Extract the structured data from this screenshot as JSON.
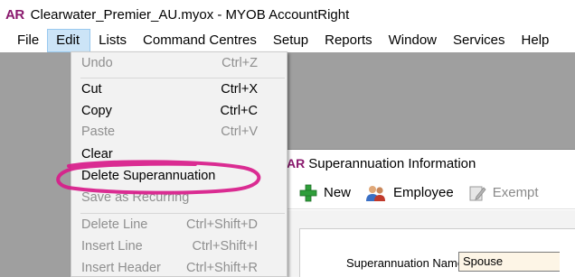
{
  "titlebar": {
    "logo": "AR",
    "title": "Clearwater_Premier_AU.myox - MYOB AccountRight"
  },
  "menubar": {
    "items": [
      {
        "label": "File"
      },
      {
        "label": "Edit"
      },
      {
        "label": "Lists"
      },
      {
        "label": "Command Centres"
      },
      {
        "label": "Setup"
      },
      {
        "label": "Reports"
      },
      {
        "label": "Window"
      },
      {
        "label": "Services"
      },
      {
        "label": "Help"
      }
    ]
  },
  "edit_menu": {
    "items": [
      {
        "label": "Undo",
        "shortcut": "Ctrl+Z",
        "enabled": false
      },
      {
        "label": "Cut",
        "shortcut": "Ctrl+X",
        "enabled": true
      },
      {
        "label": "Copy",
        "shortcut": "Ctrl+C",
        "enabled": true
      },
      {
        "label": "Paste",
        "shortcut": "Ctrl+V",
        "enabled": false
      },
      {
        "label": "Clear",
        "shortcut": "",
        "enabled": true
      },
      {
        "label": "Delete Superannuation",
        "shortcut": "",
        "enabled": true,
        "highlighted": true
      },
      {
        "label": "Save as Recurring",
        "shortcut": "",
        "enabled": false
      },
      {
        "label": "Delete Line",
        "shortcut": "Ctrl+Shift+D",
        "enabled": false
      },
      {
        "label": "Insert Line",
        "shortcut": "Ctrl+Shift+I",
        "enabled": false
      },
      {
        "label": "Insert Header",
        "shortcut": "Ctrl+Shift+R",
        "enabled": false
      }
    ]
  },
  "child_window": {
    "logo": "AR",
    "title": "Superannuation Information",
    "toolbar": {
      "new_label": "New",
      "employee_label": "Employee",
      "exempt_label": "Exempt"
    },
    "form": {
      "name_label": "Superannuation Name:",
      "name_value": "Spouse"
    }
  },
  "colors": {
    "brand": "#8a1a6e",
    "highlight_ring": "#d81b8a",
    "workspace": "#9f9f9f",
    "menu_active": "#cce4f7",
    "input_bg": "#fdf5e6"
  }
}
